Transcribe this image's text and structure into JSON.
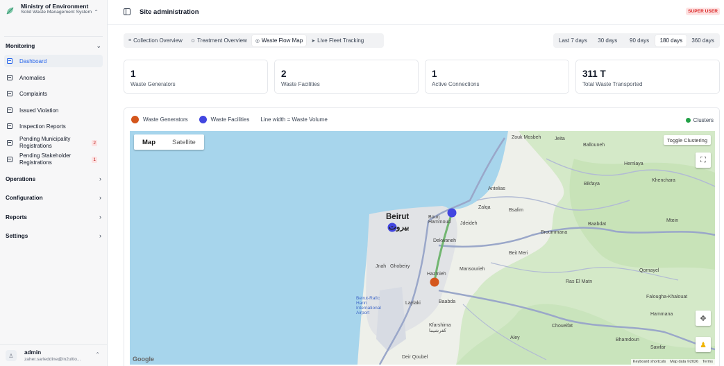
{
  "sidebar": {
    "org_title": "Ministry of Environment",
    "org_subtitle": "Solid Waste Management System",
    "sections": {
      "monitoring": "Monitoring",
      "operations": "Operations",
      "configuration": "Configuration",
      "reports": "Reports",
      "settings": "Settings"
    },
    "items": [
      {
        "label": "Dashboard",
        "icon": "dashboard-icon"
      },
      {
        "label": "Anomalies",
        "icon": "anomalies-icon"
      },
      {
        "label": "Complaints",
        "icon": "complaints-icon"
      },
      {
        "label": "Issued Violation",
        "icon": "violation-icon"
      },
      {
        "label": "Inspection Reports",
        "icon": "inspection-icon"
      },
      {
        "label": "Pending Municipality Registrations",
        "badge": "2",
        "icon": "registration-icon"
      },
      {
        "label": "Pending Stakeholder Registrations",
        "badge": "1",
        "icon": "registration-icon"
      }
    ],
    "user": {
      "name": "admin",
      "email": "zaher.sarleddine@in2ultio..."
    }
  },
  "header": {
    "title": "Site administration",
    "role_badge": "SUPER USER"
  },
  "tabs": [
    {
      "label": "Collection Overview",
      "icon": "list-icon",
      "glyph": "≡"
    },
    {
      "label": "Treatment Overview",
      "icon": "recycle-icon",
      "glyph": "♲"
    },
    {
      "label": "Waste Flow Map",
      "icon": "target-icon",
      "glyph": "◎"
    },
    {
      "label": "Live Fleet Tracking",
      "icon": "truck-icon",
      "glyph": "➤"
    }
  ],
  "ranges": [
    "Last 7 days",
    "30 days",
    "90 days",
    "180 days",
    "360 days"
  ],
  "selected_range": "180 days",
  "stats": [
    {
      "value": "1",
      "label": "Waste Generators"
    },
    {
      "value": "2",
      "label": "Waste Facilities"
    },
    {
      "value": "1",
      "label": "Active Connections"
    },
    {
      "value": "311 T",
      "label": "Total Waste Transported"
    }
  ],
  "legend": {
    "generators": "Waste Generators",
    "facilities": "Waste Facilities",
    "line_width": "Line width = Waste Volume",
    "clusters": "Clusters"
  },
  "colors": {
    "generator": "#d4561c",
    "facility": "#4246e0",
    "cluster": "#22a047",
    "flow_line": "#6cb36a",
    "water": "#a7d5ec",
    "land": "#eef0ea",
    "greenery": "#cfe7c2",
    "accent": "#2563eb"
  },
  "map": {
    "type_buttons": [
      "Map",
      "Satellite"
    ],
    "toggle_clustering": "Toggle Clustering",
    "google": "Google",
    "attribution": [
      "Keyboard shortcuts",
      "Map data ©2026",
      "Terms"
    ],
    "places": {
      "beirut": "Beirut",
      "beirut_ar": "بيروت",
      "bourj_hammoud": "Bourj Hammoud",
      "jdeideh": "Jdeideh",
      "zalqa": "Zalqa",
      "antelias": "Antelias",
      "bsalim": "Bsalim",
      "dekwaneh": "Dekwaneh",
      "jnah": "Jnah",
      "ghobeiry": "Ghobeiry",
      "hazmieh": "Hazmieh",
      "mansourieh": "Mansourieh",
      "beit_meri": "Beit Meri",
      "broummana": "Broummana",
      "baabdat": "Baabdat",
      "zouk_mosbeh": "Zouk Mosbeh",
      "jeita": "Jeita",
      "ballouneh": "Ballouneh",
      "hemlaya": "Hemlaya",
      "bikfaya": "Bikfaya",
      "khenchara": "Khenchara",
      "mtein": "Mtein",
      "ras_el_matn": "Ras El Matn",
      "qornayel": "Qornayel",
      "falougha": "Falougha-Khalouat",
      "baabda": "Baabda",
      "laylaki": "Laylaki",
      "kfarshima": "Kfarshima",
      "choueifat": "Choueifat",
      "airport": "Beirut-Rafic Hariri International Airport",
      "aley": "Aley",
      "hammana": "Hammana",
      "bhamdoun": "Bhamdoun",
      "kfarchima_ar": "كفرشيما",
      "deir_qoubel": "Deir Qoubel",
      "sawfar": "Sawfar"
    }
  }
}
